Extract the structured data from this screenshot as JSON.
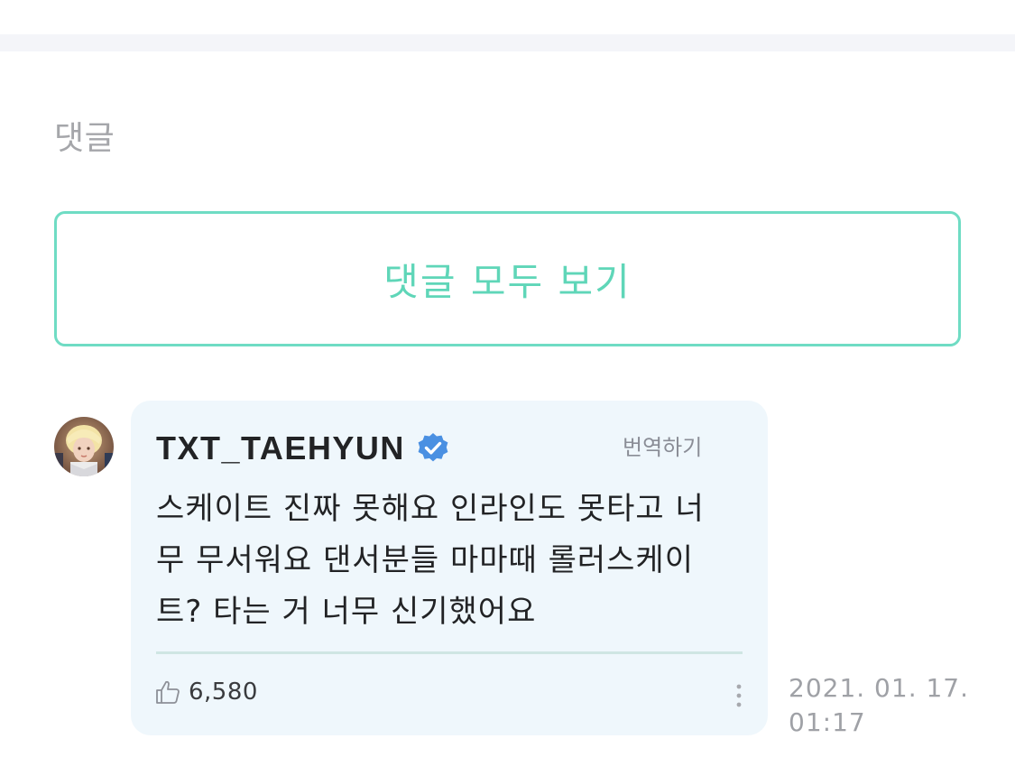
{
  "comments_section": {
    "title": "댓글",
    "view_all_label": "댓글 모두 보기"
  },
  "comment": {
    "author": "TXT_TAEHYUN",
    "verified": true,
    "translate_label": "번역하기",
    "text": "스케이트 진짜 못해요 인라인도 못타고 너무 무서워요 댄서분들 마마때 롤러스케이트? 타는 거 너무 신기했어요",
    "likes": "6,580",
    "timestamp": "2021. 01. 17. 01:17"
  },
  "icons": {
    "avatar": "profile-avatar",
    "verified": "verified-badge-icon",
    "like": "thumbs-up-icon",
    "more": "more-vertical-icon"
  },
  "colors": {
    "accent": "#5fd6b8",
    "border_accent": "#6fdcc4",
    "bubble_bg": "#eff7fc",
    "divider": "#f4f5f9",
    "verified_blue": "#4a90e2"
  }
}
